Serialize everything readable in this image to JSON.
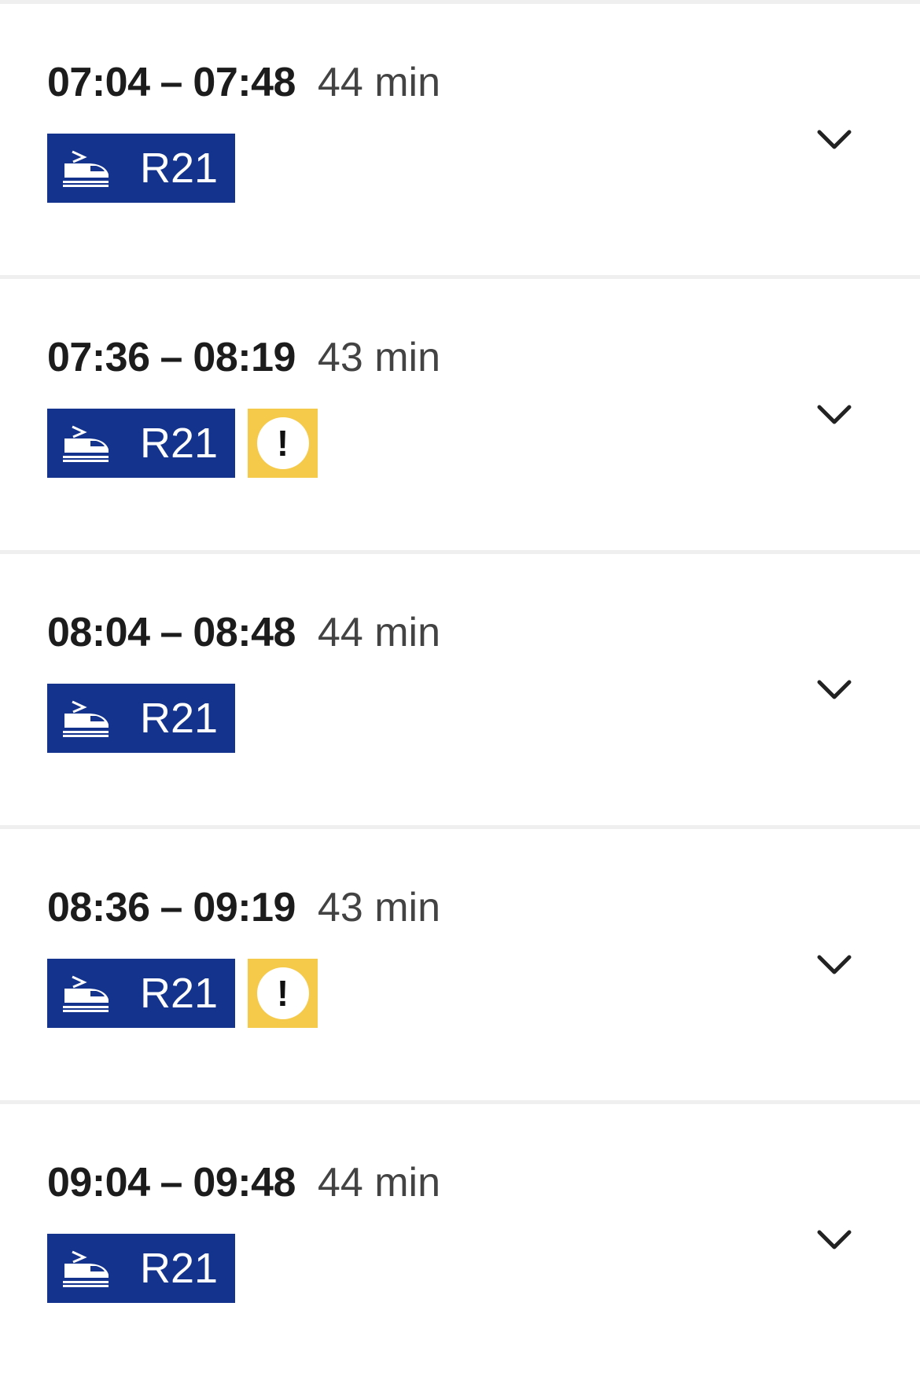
{
  "separator": "–",
  "connections": [
    {
      "departure": "07:04",
      "arrival": "07:48",
      "duration": "44 min",
      "line": "R21"
    },
    {
      "departure": "07:36",
      "arrival": "08:19",
      "duration": "43 min",
      "line": "R21",
      "alert_symbol": "!"
    },
    {
      "departure": "08:04",
      "arrival": "08:48",
      "duration": "44 min",
      "line": "R21"
    },
    {
      "departure": "08:36",
      "arrival": "09:19",
      "duration": "43 min",
      "line": "R21",
      "alert_symbol": "!"
    },
    {
      "departure": "09:04",
      "arrival": "09:48",
      "duration": "44 min",
      "line": "R21"
    }
  ],
  "icons": {
    "mode": "regional-train-icon",
    "alert": "exclamation-icon",
    "expand": "chevron-down-icon"
  },
  "colors": {
    "line_badge": "#14338c",
    "alert_badge": "#f5c94a",
    "separator": "#efefef",
    "text": "#1c1c1c",
    "duration_text": "#434343"
  }
}
